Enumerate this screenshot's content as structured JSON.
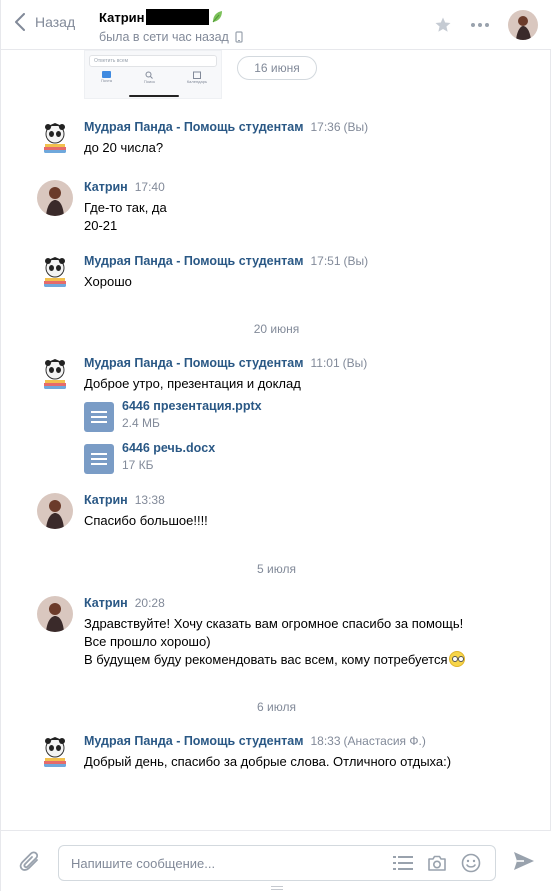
{
  "header": {
    "back_label": "Назад",
    "peer_name": "Катрин",
    "peer_status": "была в сети час назад"
  },
  "thumbnail": {
    "search_text": "Ответить всем",
    "tabs": [
      "Почта",
      "Поиск",
      "Календарь"
    ]
  },
  "messages": [
    {
      "author": "Мудрая Панда - Помощь студентам",
      "time": "17:36",
      "note": "(Вы)",
      "lines": [
        "до 20 числа?"
      ]
    },
    {
      "author": "Катрин",
      "time": "17:40",
      "note": "",
      "lines": [
        "Где-то так, да",
        "20-21"
      ]
    },
    {
      "author": "Мудрая Панда - Помощь студентам",
      "time": "17:51",
      "note": "(Вы)",
      "lines": [
        "Хорошо"
      ]
    },
    {
      "author": "Мудрая Панда - Помощь студентам",
      "time": "11:01",
      "note": "(Вы)",
      "lines": [
        "Доброе утро, презентация и доклад"
      ],
      "docs": [
        {
          "name": "6446 презентация.pptx",
          "size": "2.4 МБ"
        },
        {
          "name": "6446 речь.docx",
          "size": "17 КБ"
        }
      ]
    },
    {
      "author": "Катрин",
      "time": "13:38",
      "note": "",
      "lines": [
        "Спасибо большое!!!!"
      ]
    },
    {
      "author": "Катрин",
      "time": "20:28",
      "note": "",
      "lines": [
        "Здравствуйте! Хочу сказать вам огромное спасибо за помощь!",
        "Все прошло хорошо)",
        "В будущем буду рекомендовать вас всем, кому потребуется"
      ]
    },
    {
      "author": "Мудрая Панда - Помощь студентам",
      "time": "18:33",
      "note": "(Анастасия Ф.)",
      "lines": [
        "Добрый день, спасибо за добрые слова. Отличного отдыха:)"
      ]
    }
  ],
  "dates": [
    "16 июня",
    "20 июня",
    "5 июля",
    "6 июля"
  ],
  "composer": {
    "placeholder": "Напишите сообщение..."
  },
  "colors": {
    "link": "#2a5885",
    "muted": "#828a99",
    "border": "#e7e8ec",
    "doc_icon": "#7a9cc6"
  }
}
